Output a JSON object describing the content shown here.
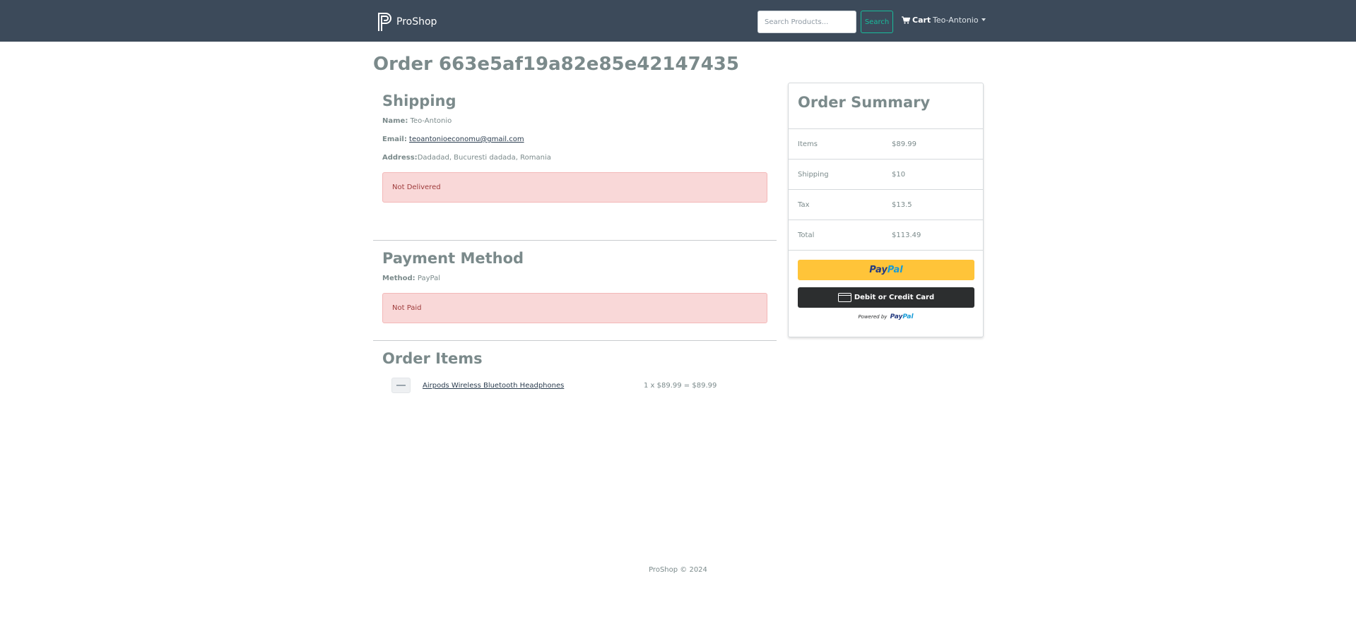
{
  "navbar": {
    "brand": "ProShop",
    "search_placeholder": "Search Products...",
    "search_button": "Search",
    "cart_label": "Cart",
    "user_label": "Teo-Antonio"
  },
  "order": {
    "title": "Order 663e5af19a82e85e42147435"
  },
  "shipping": {
    "heading": "Shipping",
    "name_label": "Name:",
    "name_value": "Teo-Antonio",
    "email_label": "Email:",
    "email_value": "teoantonioeconomu@gmail.com",
    "address_label": "Address:",
    "address_value": "Dadadad, Bucuresti dadada, Romania",
    "status": "Not Delivered"
  },
  "payment": {
    "heading": "Payment Method",
    "method_label": "Method:",
    "method_value": "PayPal",
    "status": "Not Paid"
  },
  "items": {
    "heading": "Order Items",
    "list": [
      {
        "name": "Airpods Wireless Bluetooth Headphones",
        "calc": "1 x $89.99 = $89.99"
      }
    ]
  },
  "summary": {
    "heading": "Order Summary",
    "rows": [
      {
        "label": "Items",
        "value": "$89.99"
      },
      {
        "label": "Shipping",
        "value": "$10"
      },
      {
        "label": "Tax",
        "value": "$13.5"
      },
      {
        "label": "Total",
        "value": "$113.49"
      }
    ],
    "paypal_button_dark": "Pay",
    "paypal_button_light": "Pal",
    "card_button": "Debit or Credit Card",
    "powered_by": "Powered by",
    "powered_logo_dark": "Pay",
    "powered_logo_light": "Pal"
  },
  "footer": {
    "text": "ProShop © 2024"
  },
  "colors": {
    "navbar": "#3c4a5a",
    "accent": "#18bc9c",
    "alert_bg": "#f9d8d8",
    "paypal_yellow": "#ffc439",
    "card_button": "#2c2e2f"
  },
  "icons": [
    "brand-logo-icon",
    "cart-icon",
    "caret-down-icon",
    "credit-card-icon"
  ]
}
